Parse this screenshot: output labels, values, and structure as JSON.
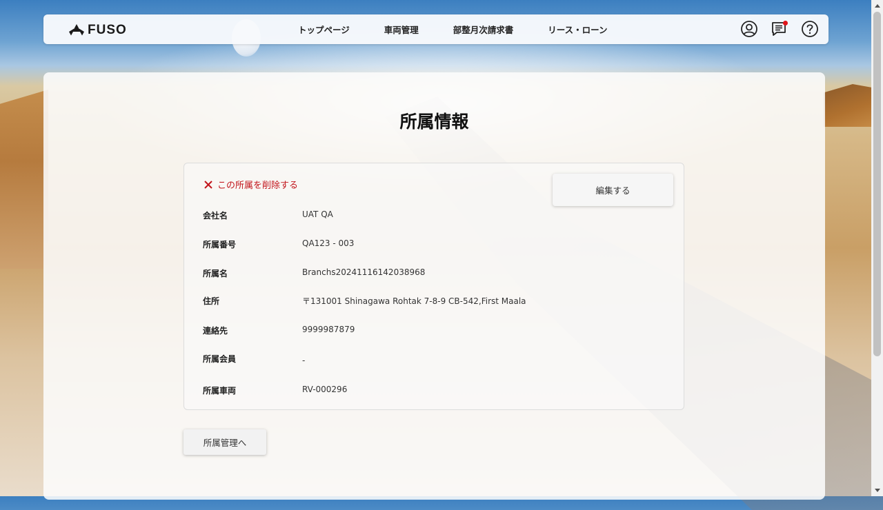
{
  "brand": {
    "logo_text": "FUSO"
  },
  "nav": {
    "links": [
      "トップページ",
      "車両管理",
      "部整月次請求書",
      "リース・ローン"
    ]
  },
  "icons": {
    "account": "user-circle-icon",
    "messages": "chat-notification-icon",
    "help": "question-circle-icon"
  },
  "colors": {
    "accent_red": "#c2161c",
    "notification": "#e0151b"
  },
  "page": {
    "title": "所属情報"
  },
  "actions": {
    "delete_label": "この所属を削除する",
    "edit_label": "編集する",
    "back_label": "所属管理へ"
  },
  "details": [
    {
      "label": "会社名",
      "value": "UAT QA"
    },
    {
      "label": "所属番号",
      "value": "QA123 - 003"
    },
    {
      "label": "所属名",
      "value": "Branchs20241116142038968"
    },
    {
      "label": "住所",
      "value": "〒131001 Shinagawa Rohtak 7-8-9 CB-542,First Maala"
    },
    {
      "label": "連絡先",
      "value": "9999987879"
    },
    {
      "label": "所属会員",
      "value": "-"
    },
    {
      "label": "所属車両",
      "value": "RV-000296"
    }
  ]
}
